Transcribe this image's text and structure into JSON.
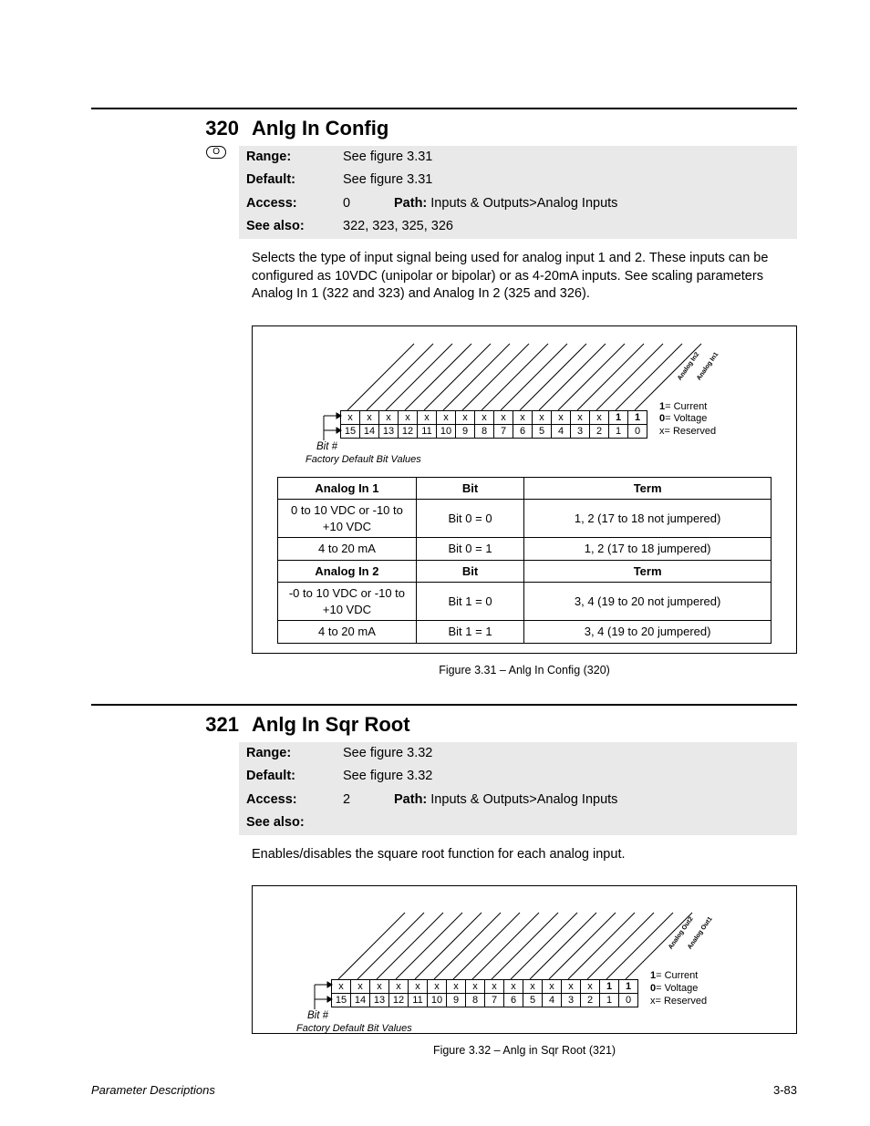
{
  "page": {
    "footer_left": "Parameter Descriptions",
    "footer_right": "3-83"
  },
  "params": [
    {
      "num": "320",
      "title": "Anlg In Config",
      "badge": "O",
      "range": "See figure 3.31",
      "default": "See figure 3.31",
      "access": "0",
      "path_label": "Path:",
      "path": "Inputs & Outputs>Analog Inputs",
      "see_also": "322, 323, 325, 326",
      "body": "Selects the type of input signal being used for analog input 1 and 2. These inputs can be configured as 10VDC (unipolar or bipolar) or as 4-20mA inputs. See scaling parameters Analog In 1 (322 and 323) and Analog In 2 (325 and 326).",
      "figure_caption": "Figure 3.31 – Anlg In Config (320)"
    },
    {
      "num": "321",
      "title": "Anlg In Sqr Root",
      "badge": "",
      "range": "See figure 3.32",
      "default": "See figure 3.32",
      "access": "2",
      "path_label": "Path:",
      "path": "Inputs & Outputs>Analog Inputs",
      "see_also": "",
      "body": "Enables/disables the square root function for each analog input.",
      "figure_caption": "Figure 3.32 – Anlg in Sqr Root (321)"
    }
  ],
  "labels": {
    "range": "Range:",
    "default": "Default:",
    "access": "Access:",
    "see_also": "See also:"
  },
  "bit_diagram": {
    "bit_hash": "Bit #",
    "factory_default": "Factory Default Bit Values",
    "legend_1": "1",
    "legend_1_txt": "= Current",
    "legend_0": "0",
    "legend_0_txt": "= Voltage",
    "legend_x": "x",
    "legend_x_txt": "= Reserved",
    "labels_a": [
      "Analog In2",
      "Analog In1"
    ],
    "labels_b": [
      "Analog Out2",
      "Analog Out1"
    ],
    "bit_numbers": [
      "15",
      "14",
      "13",
      "12",
      "11",
      "10",
      "9",
      "8",
      "7",
      "6",
      "5",
      "4",
      "3",
      "2",
      "1",
      "0"
    ],
    "values_row": [
      "x",
      "x",
      "x",
      "x",
      "x",
      "x",
      "x",
      "x",
      "x",
      "x",
      "x",
      "x",
      "x",
      "x",
      "1",
      "1"
    ]
  },
  "cfg_table": {
    "headers_a": [
      "Analog In 1",
      "Bit",
      "Term"
    ],
    "rows_a": [
      [
        "0 to 10 VDC or -10 to +10 VDC",
        "Bit 0 = 0",
        "1, 2 (17 to 18 not jumpered)"
      ],
      [
        "4 to 20 mA",
        "Bit 0 = 1",
        "1, 2 (17 to 18 jumpered)"
      ]
    ],
    "headers_b": [
      "Analog In 2",
      "Bit",
      "Term"
    ],
    "rows_b": [
      [
        "-0 to 10 VDC or -10 to +10 VDC",
        "Bit 1 = 0",
        "3, 4 (19 to 20 not jumpered)"
      ],
      [
        "4 to 20 mA",
        "Bit 1 = 1",
        "3, 4 (19 to 20 jumpered)"
      ]
    ]
  }
}
